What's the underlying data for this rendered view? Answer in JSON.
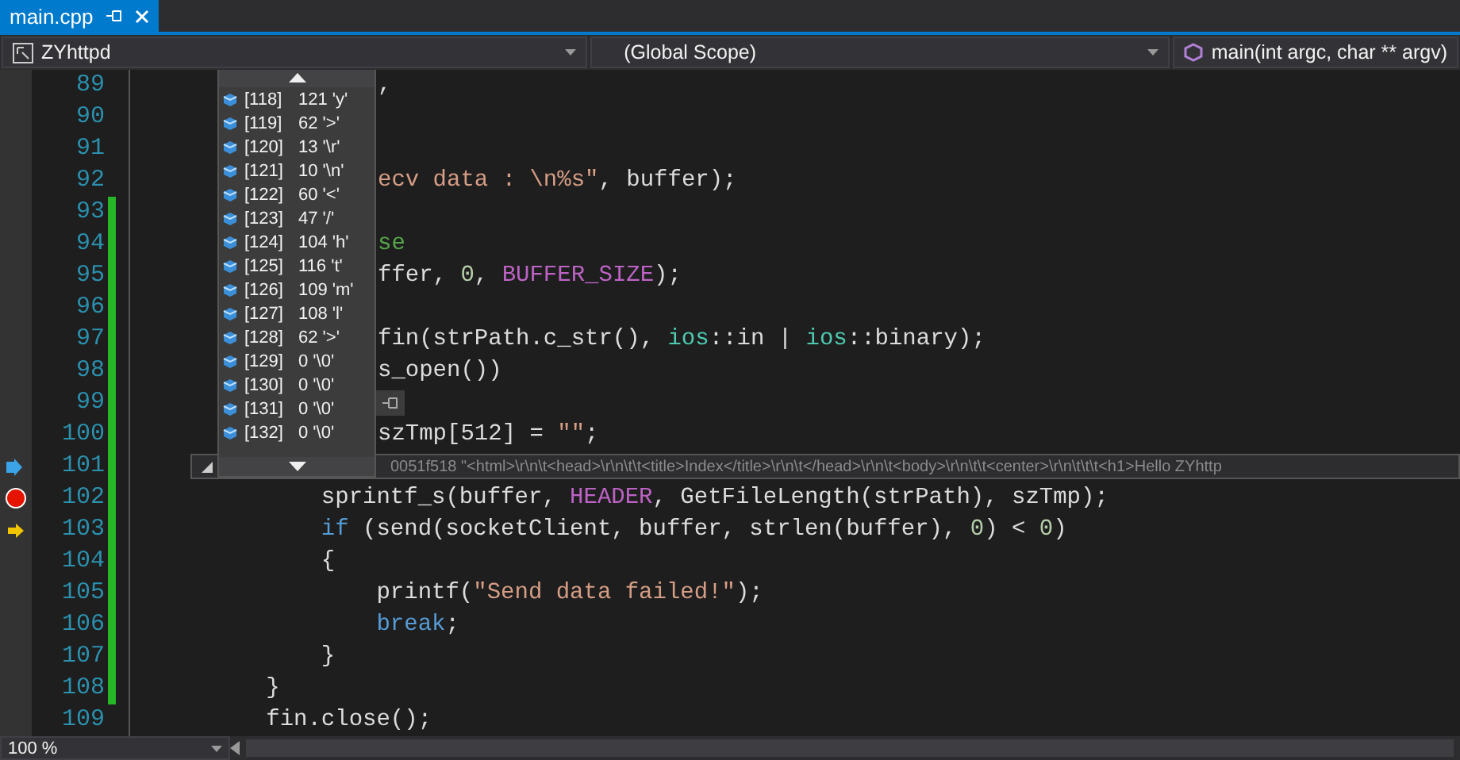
{
  "tab": {
    "title": "main.cpp",
    "selected": true
  },
  "nav": [
    {
      "label": "ZYhttpd",
      "kind": "project"
    },
    {
      "label": "(Global Scope)",
      "kind": "scope"
    },
    {
      "label": "main(int argc, char ** argv)",
      "kind": "function"
    }
  ],
  "lines": [
    {
      "number": "89",
      "kind": "code",
      "changed": false,
      "tokens": [
        {
          "kind": "plain",
          "text": ","
        }
      ]
    },
    {
      "number": "90",
      "kind": "code",
      "changed": false
    },
    {
      "number": "91",
      "kind": "code",
      "changed": false
    },
    {
      "number": "92",
      "kind": "code",
      "changed": false,
      "tokens": [
        {
          "kind": "string",
          "text": "ecv data : \\n%s\""
        },
        {
          "kind": "plain",
          "text": ", buffer);"
        }
      ]
    },
    {
      "number": "93",
      "kind": "code",
      "changed": true
    },
    {
      "number": "94",
      "kind": "code",
      "changed": true,
      "tokens": [
        {
          "kind": "comment",
          "text": "se"
        }
      ]
    },
    {
      "number": "95",
      "kind": "code",
      "changed": true,
      "tokens": [
        {
          "kind": "plain",
          "text": "ffer, "
        },
        {
          "kind": "number",
          "text": "0"
        },
        {
          "kind": "plain",
          "text": ", "
        },
        {
          "kind": "macro",
          "text": "BUFFER_SIZE"
        },
        {
          "kind": "plain",
          "text": ");"
        }
      ]
    },
    {
      "number": "96",
      "kind": "code",
      "changed": true
    },
    {
      "number": "97",
      "kind": "code",
      "changed": true,
      "tokens": [
        {
          "kind": "plain",
          "text": "fin(strPath.c_str(), "
        },
        {
          "kind": "type",
          "text": "ios"
        },
        {
          "kind": "plain",
          "text": "::in | "
        },
        {
          "kind": "type",
          "text": "ios"
        },
        {
          "kind": "plain",
          "text": "::binary);"
        }
      ]
    },
    {
      "number": "98",
      "kind": "code",
      "changed": true,
      "tokens": [
        {
          "kind": "plain",
          "text": "s_open())"
        }
      ]
    },
    {
      "number": "99",
      "kind": "code",
      "changed": true
    },
    {
      "number": "100",
      "kind": "code",
      "changed": true,
      "tokens": [
        {
          "kind": "plain",
          "text": "szTmp[512] = "
        },
        {
          "kind": "string",
          "text": "\"\""
        },
        {
          "kind": "plain",
          "text": ";"
        }
      ]
    },
    {
      "number": "101",
      "kind": "pin",
      "changed": true
    },
    {
      "number": "102",
      "kind": "breakpoint",
      "changed": true,
      "tokens": [
        {
          "kind": "plain",
          "text": "            sprintf_s(buffer, "
        },
        {
          "kind": "macro",
          "text": "HEADER"
        },
        {
          "kind": "plain",
          "text": ", GetFileLength(strPath), szTmp);"
        }
      ]
    },
    {
      "number": "103",
      "kind": "next-statement",
      "changed": true,
      "tokens": [
        {
          "kind": "keyword",
          "text": "            if"
        },
        {
          "kind": "plain",
          "text": " (send(socketClient, buffer, strlen(buffer), "
        },
        {
          "kind": "number",
          "text": "0"
        },
        {
          "kind": "plain",
          "text": ") < "
        },
        {
          "kind": "number",
          "text": "0"
        },
        {
          "kind": "plain",
          "text": ")"
        }
      ]
    },
    {
      "number": "104",
      "kind": "code",
      "changed": true,
      "tokens": [
        {
          "kind": "plain",
          "text": "            {"
        }
      ]
    },
    {
      "number": "105",
      "kind": "code",
      "changed": true,
      "tokens": [
        {
          "kind": "plain",
          "text": "                printf("
        },
        {
          "kind": "string",
          "text": "\"Send data failed!\""
        },
        {
          "kind": "plain",
          "text": ");"
        }
      ]
    },
    {
      "number": "106",
      "kind": "code",
      "changed": true,
      "tokens": [
        {
          "kind": "keyword",
          "text": "                break"
        },
        {
          "kind": "plain",
          "text": ";"
        }
      ]
    },
    {
      "number": "107",
      "kind": "code",
      "changed": true,
      "tokens": [
        {
          "kind": "plain",
          "text": "            }"
        }
      ]
    },
    {
      "number": "108",
      "kind": "code",
      "changed": true,
      "tokens": [
        {
          "kind": "plain",
          "text": "        }"
        }
      ]
    },
    {
      "number": "109",
      "kind": "code",
      "changed": false,
      "tokens": [
        {
          "kind": "plain",
          "text": "        fin.close();"
        }
      ]
    }
  ],
  "datatip": {
    "address": "0051f518",
    "value": "\"<html>\\r\\n\\t<head>\\r\\n\\t\\t<title>Index</title>\\r\\n\\t</head>\\r\\n\\t<body>\\r\\n\\t\\t<center>\\r\\n\\t\\t\\t<h1>Hello ZYhttp"
  },
  "elements": [
    {
      "index": "[118]",
      "value": "121 'y'"
    },
    {
      "index": "[119]",
      "value": "62 '>'"
    },
    {
      "index": "[120]",
      "value": "13 '\\r'"
    },
    {
      "index": "[121]",
      "value": "10 '\\n'"
    },
    {
      "index": "[122]",
      "value": "60 '<'"
    },
    {
      "index": "[123]",
      "value": "47 '/'"
    },
    {
      "index": "[124]",
      "value": "104 'h'"
    },
    {
      "index": "[125]",
      "value": "116 't'"
    },
    {
      "index": "[126]",
      "value": "109 'm'"
    },
    {
      "index": "[127]",
      "value": "108 'l'"
    },
    {
      "index": "[128]",
      "value": "62 '>'"
    },
    {
      "index": "[129]",
      "value": "0 '\\0'"
    },
    {
      "index": "[130]",
      "value": "0 '\\0'"
    },
    {
      "index": "[131]",
      "value": "0 '\\0'"
    },
    {
      "index": "[132]",
      "value": "0 '\\0'"
    }
  ],
  "zoom": "100 %"
}
